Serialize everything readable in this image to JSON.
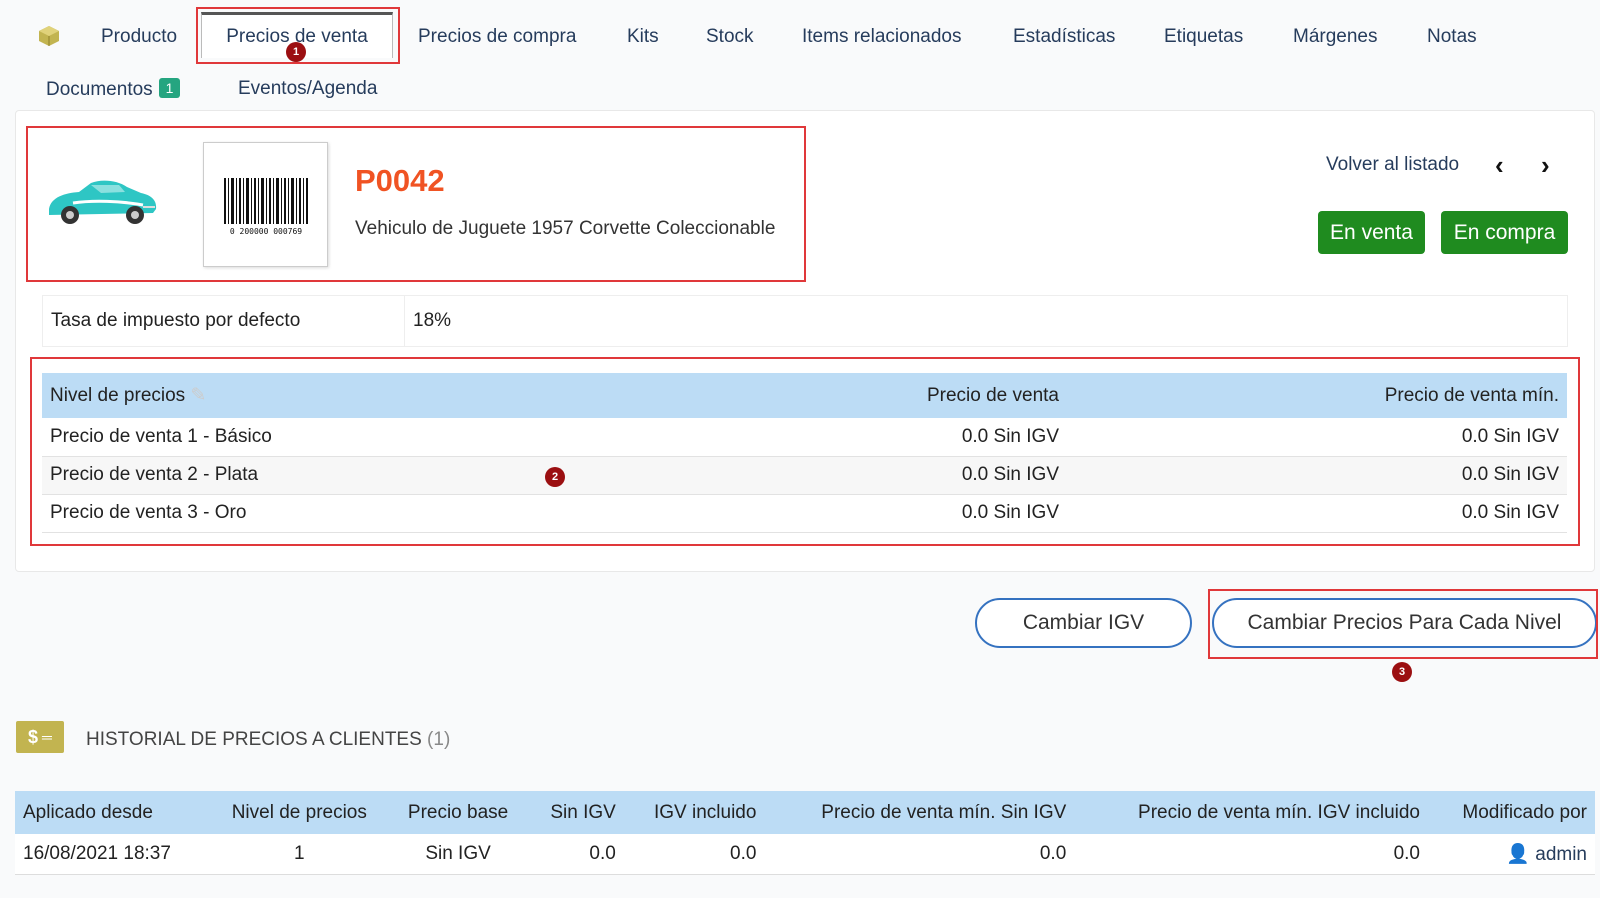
{
  "tabs": {
    "producto": "Producto",
    "precios_venta": "Precios de venta",
    "precios_compra": "Precios de compra",
    "kits": "Kits",
    "stock": "Stock",
    "items": "Items relacionados",
    "estadisticas": "Estadísticas",
    "etiquetas": "Etiquetas",
    "margenes": "Márgenes",
    "notas": "Notas",
    "documentos": "Documentos",
    "documentos_count": "1",
    "eventos": "Eventos/Agenda"
  },
  "markers": {
    "m1": "1",
    "m2": "2",
    "m3": "3"
  },
  "product": {
    "ref": "P0042",
    "label": "Vehiculo de Juguete 1957 Corvette Coleccionable",
    "barcode": "0 200000 000769"
  },
  "header_actions": {
    "back": "Volver al listado",
    "prev_icon": "chevron-left",
    "next_icon": "chevron-right",
    "on_sale": "En venta",
    "on_buy": "En compra"
  },
  "tax": {
    "label": "Tasa de impuesto por defecto",
    "value": "18%"
  },
  "price_table": {
    "headers": {
      "level": "Nivel de precios",
      "price": "Precio de venta",
      "min_price": "Precio de venta mín."
    },
    "rows": [
      {
        "level": "Precio de venta 1 - Básico",
        "price": "0.0 Sin IGV",
        "min": "0.0 Sin IGV"
      },
      {
        "level": "Precio de venta 2 - Plata",
        "price": "0.0 Sin IGV",
        "min": "0.0 Sin IGV"
      },
      {
        "level": "Precio de venta 3 - Oro",
        "price": "0.0 Sin IGV",
        "min": "0.0 Sin IGV"
      }
    ]
  },
  "actions": {
    "change_vat": "Cambiar IGV",
    "change_levels": "Cambiar Precios Para Cada Nivel"
  },
  "history": {
    "icon_text": "$",
    "title": "HISTORIAL DE PRECIOS A CLIENTES",
    "count": "(1)",
    "headers": [
      "Aplicado desde",
      "Nivel de precios",
      "Precio base",
      "Sin IGV",
      "IGV incluido",
      "Precio de venta mín. Sin IGV",
      "Precio de venta mín. IGV incluido",
      "Modificado por"
    ],
    "row": {
      "date": "16/08/2021 18:37",
      "level": "1",
      "base": "Sin IGV",
      "ht": "0.0",
      "ttc": "0.0",
      "min_ht": "0.0",
      "min_ttc": "0.0",
      "user": "admin"
    }
  },
  "colors": {
    "accent_ref": "#f05323",
    "btn_green": "#1f8b1f",
    "table_header": "#bcdcf5",
    "marker": "#9b0f11",
    "highlight": "#e0383a"
  }
}
